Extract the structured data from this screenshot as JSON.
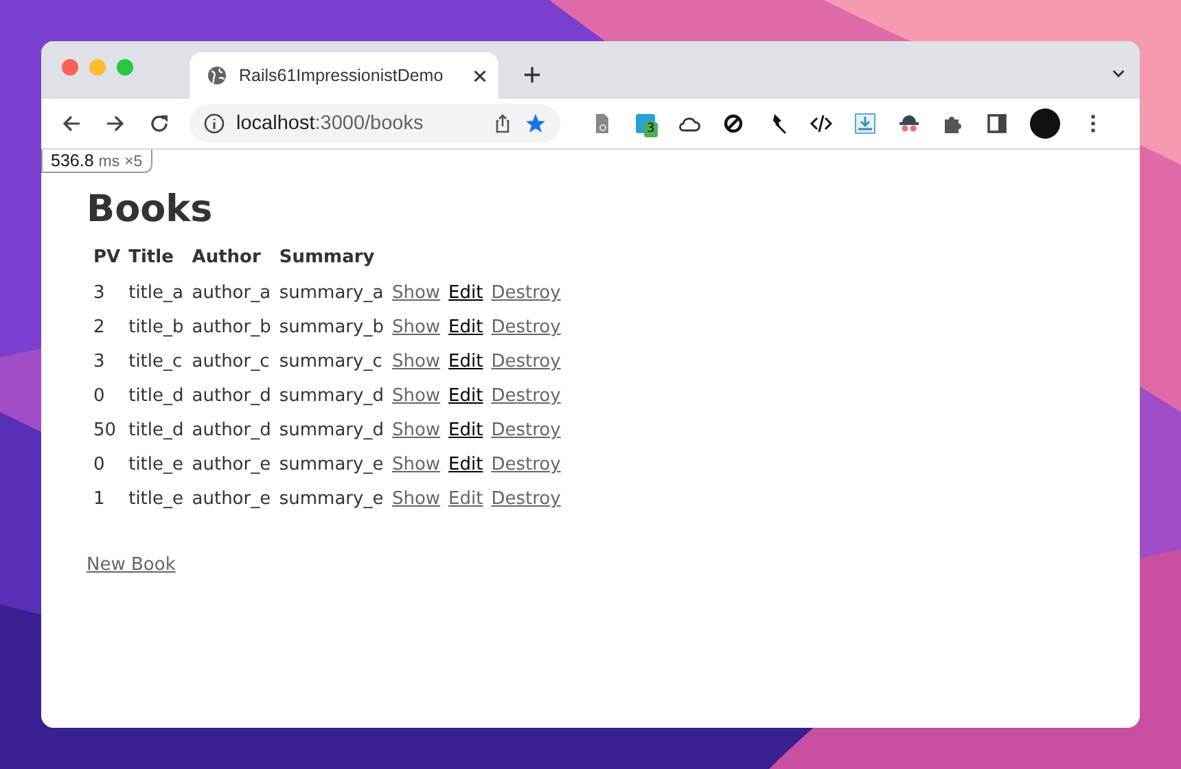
{
  "browser": {
    "tab_title": "Rails61ImpressionistDemo",
    "url_host": "localhost",
    "url_path": ":3000/books",
    "extension_badge": "3"
  },
  "timing": {
    "value": "536.8",
    "unit": "ms",
    "count": "×5"
  },
  "page": {
    "heading": "Books",
    "columns": [
      "PV",
      "Title",
      "Author",
      "Summary"
    ],
    "rows": [
      {
        "cells": [
          "3",
          "title_a",
          "author_a",
          "summary_a"
        ],
        "links": [
          {
            "label": "Show",
            "visited": false
          },
          {
            "label": "Edit",
            "visited": true
          },
          {
            "label": "Destroy",
            "visited": false
          }
        ]
      },
      {
        "cells": [
          "2",
          "title_b",
          "author_b",
          "summary_b"
        ],
        "links": [
          {
            "label": "Show",
            "visited": false
          },
          {
            "label": "Edit",
            "visited": true
          },
          {
            "label": "Destroy",
            "visited": false
          }
        ]
      },
      {
        "cells": [
          "3",
          "title_c",
          "author_c",
          "summary_c"
        ],
        "links": [
          {
            "label": "Show",
            "visited": false
          },
          {
            "label": "Edit",
            "visited": true
          },
          {
            "label": "Destroy",
            "visited": false
          }
        ]
      },
      {
        "cells": [
          "0",
          "title_d",
          "author_d",
          "summary_d"
        ],
        "links": [
          {
            "label": "Show",
            "visited": false
          },
          {
            "label": "Edit",
            "visited": true
          },
          {
            "label": "Destroy",
            "visited": false
          }
        ]
      },
      {
        "cells": [
          "50",
          "title_d",
          "author_d",
          "summary_d"
        ],
        "links": [
          {
            "label": "Show",
            "visited": false
          },
          {
            "label": "Edit",
            "visited": true
          },
          {
            "label": "Destroy",
            "visited": false
          }
        ]
      },
      {
        "cells": [
          "0",
          "title_e",
          "author_e",
          "summary_e"
        ],
        "links": [
          {
            "label": "Show",
            "visited": false
          },
          {
            "label": "Edit",
            "visited": true
          },
          {
            "label": "Destroy",
            "visited": false
          }
        ]
      },
      {
        "cells": [
          "1",
          "title_e",
          "author_e",
          "summary_e"
        ],
        "links": [
          {
            "label": "Show",
            "visited": false
          },
          {
            "label": "Edit",
            "visited": false
          },
          {
            "label": "Destroy",
            "visited": false
          }
        ]
      }
    ],
    "new_link": "New Book"
  }
}
